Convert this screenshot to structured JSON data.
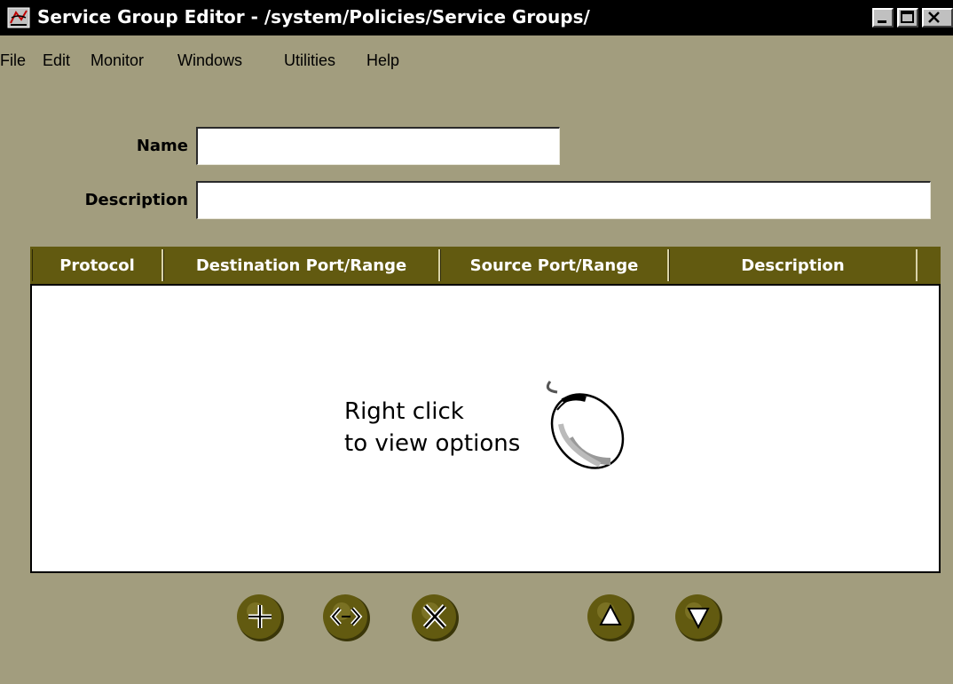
{
  "window": {
    "title": "Service Group Editor - /system/Policies/Service Groups/"
  },
  "menu": [
    "File",
    "Edit",
    "Monitor",
    "Windows",
    "Utilities",
    "Help"
  ],
  "form": {
    "name_label": "Name",
    "name_value": "",
    "description_label": "Description",
    "description_value": ""
  },
  "table": {
    "columns": [
      "Protocol",
      "Destination Port/Range",
      "Source Port/Range",
      "Description"
    ],
    "rows": [],
    "hint_line1": "Right click",
    "hint_line2": "to view options"
  },
  "toolbar": {
    "buttons": [
      "add",
      "edit",
      "delete",
      "move-up",
      "move-down"
    ]
  },
  "colors": {
    "background": "#a29d7e",
    "header": "#625a10",
    "button": "#625a10"
  }
}
